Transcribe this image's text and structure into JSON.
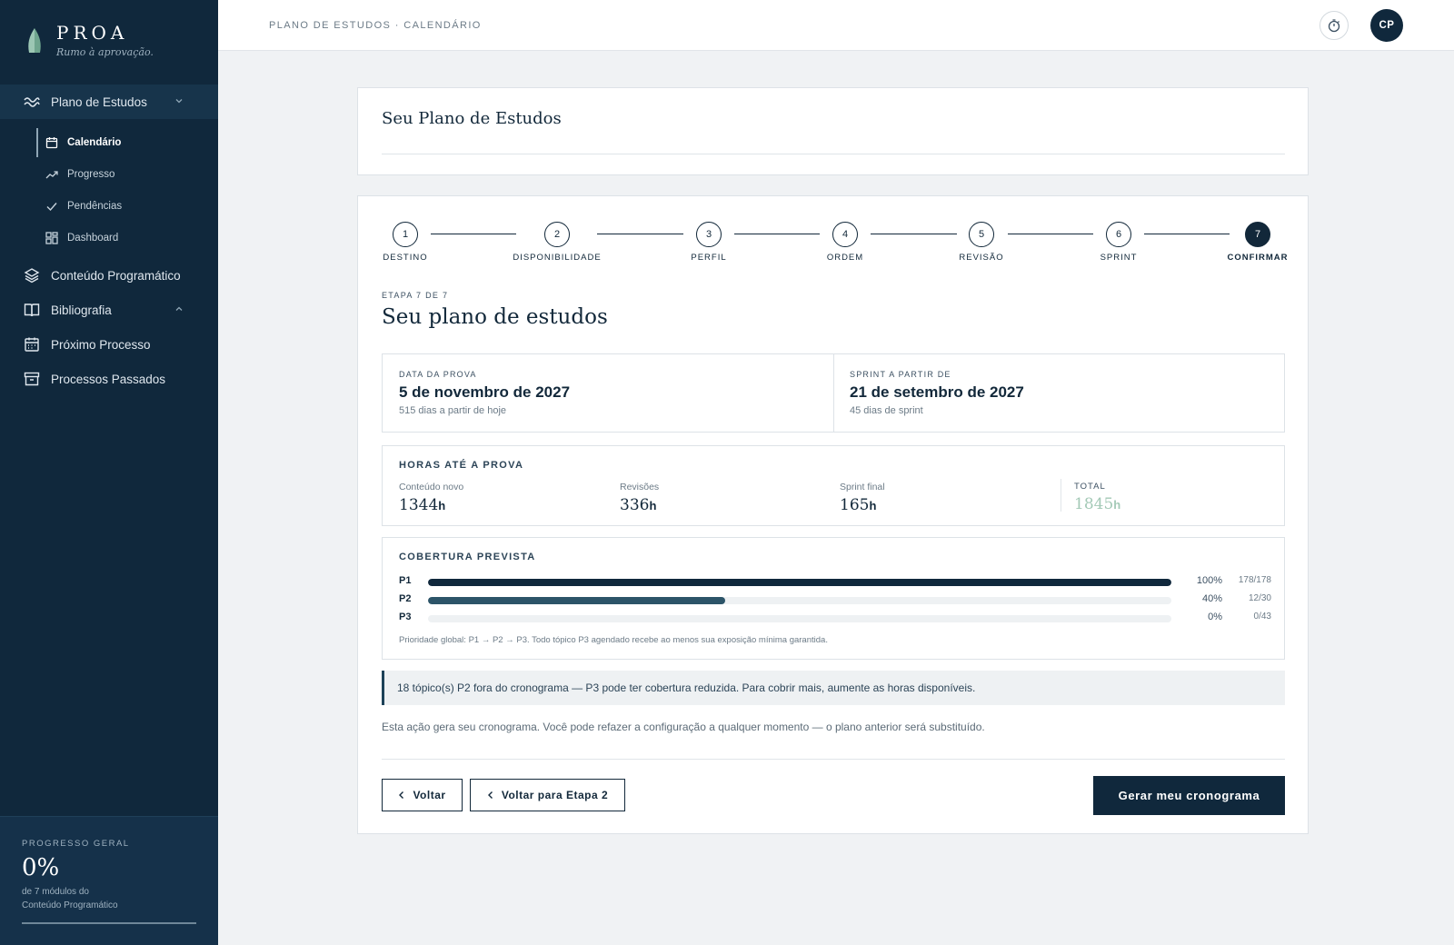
{
  "brand": {
    "name": "PROA",
    "tagline": "Rumo à aprovação."
  },
  "sidebar": {
    "nav": [
      {
        "label": "Plano de Estudos",
        "icon": "wave-icon",
        "expanded": true
      },
      {
        "label": "Conteúdo Programático",
        "icon": "layers-icon"
      },
      {
        "label": "Bibliografia",
        "icon": "book-icon",
        "expanded": false
      },
      {
        "label": "Próximo Processo",
        "icon": "calendar-icon"
      },
      {
        "label": "Processos Passados",
        "icon": "archive-icon"
      }
    ],
    "subnav": [
      {
        "label": "Calendário",
        "icon": "calendar-icon",
        "active": true
      },
      {
        "label": "Progresso",
        "icon": "trend-up-icon"
      },
      {
        "label": "Pendências",
        "icon": "check-icon"
      },
      {
        "label": "Dashboard",
        "icon": "grid-icon"
      }
    ],
    "footer": {
      "label": "PROGRESSO GERAL",
      "percent": "0%",
      "sub1": "de 7 módulos do",
      "sub2": "Conteúdo Programático",
      "progress": 0
    }
  },
  "topbar": {
    "breadcrumb": "PLANO DE ESTUDOS · CALENDÁRIO",
    "avatar": "CP"
  },
  "header_card": {
    "title": "Seu Plano de Estudos"
  },
  "stepper": {
    "steps": [
      {
        "num": "1",
        "label": "DESTINO"
      },
      {
        "num": "2",
        "label": "DISPONIBILIDADE"
      },
      {
        "num": "3",
        "label": "PERFIL"
      },
      {
        "num": "4",
        "label": "ORDEM"
      },
      {
        "num": "5",
        "label": "REVISÃO"
      },
      {
        "num": "6",
        "label": "SPRINT"
      },
      {
        "num": "7",
        "label": "CONFIRMAR",
        "active": true
      }
    ]
  },
  "stage": {
    "eyebrow": "ETAPA 7 DE 7",
    "title": "Seu plano de estudos"
  },
  "dates": {
    "exam": {
      "label": "DATA DA PROVA",
      "value": "5 de novembro de 2027",
      "sub": "515 dias a partir de hoje"
    },
    "sprint": {
      "label": "SPRINT A PARTIR DE",
      "value": "21 de setembro de 2027",
      "sub": "45 dias de sprint"
    }
  },
  "hours": {
    "title": "HORAS ATÉ A PROVA",
    "unit": "h",
    "items": [
      {
        "label": "Conteúdo novo",
        "value": "1344"
      },
      {
        "label": "Revisões",
        "value": "336"
      },
      {
        "label": "Sprint final",
        "value": "165"
      }
    ],
    "total": {
      "label": "TOTAL",
      "value": "1845"
    }
  },
  "coverage": {
    "title": "COBERTURA PREVISTA",
    "rows": [
      {
        "priority": "P1",
        "fraction": 1.0,
        "percent": "100%",
        "count": "178/178",
        "color": "#10283c"
      },
      {
        "priority": "P2",
        "fraction": 0.4,
        "percent": "40%",
        "count": "12/30",
        "color": "#2c5468"
      },
      {
        "priority": "P3",
        "fraction": 0.0,
        "percent": "0%",
        "count": "0/43",
        "color": "#2c5468"
      }
    ],
    "note": "Prioridade global: P1 → P2 → P3. Todo tópico P3 agendado recebe ao menos sua exposição mínima garantida."
  },
  "alert": "18 tópico(s) P2 fora do cronograma — P3 pode ter cobertura reduzida. Para cobrir mais, aumente as horas disponíveis.",
  "note": "Esta ação gera seu cronograma. Você pode refazer a configuração a qualquer momento — o plano anterior será substituído.",
  "buttons": {
    "back": "Voltar",
    "back_step2": "Voltar para Etapa 2",
    "generate": "Gerar meu cronograma"
  },
  "colors": {
    "primary": "#10283c",
    "accent_total": "#a3c9b6",
    "background": "#f0f2f4"
  }
}
